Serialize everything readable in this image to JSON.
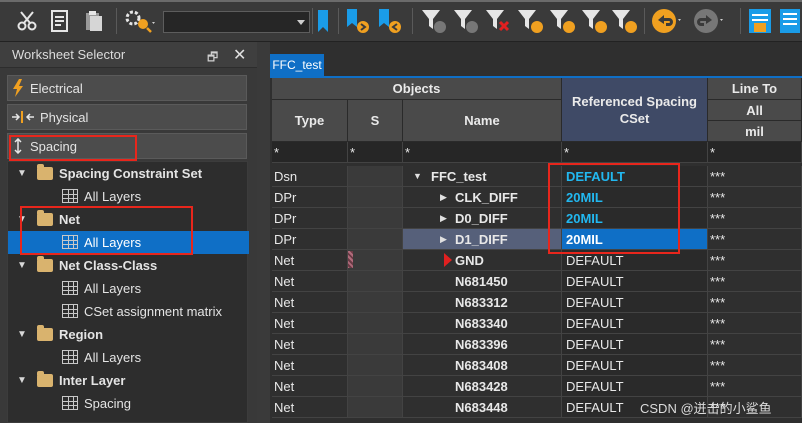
{
  "left_panel": {
    "title": "Worksheet Selector",
    "pin_glyph": "🗗",
    "close_glyph": "✕",
    "categories": [
      {
        "label": "Electrical",
        "icon": "lightning-icon"
      },
      {
        "label": "Physical",
        "icon": "physical-arrows-icon"
      },
      {
        "label": "Spacing",
        "icon": "spacing-icon"
      }
    ],
    "tree": [
      {
        "label": "Spacing Constraint Set",
        "kind": "folder"
      },
      {
        "label": "All Layers",
        "kind": "worksheet"
      },
      {
        "label": "Net",
        "kind": "folder"
      },
      {
        "label": "All Layers",
        "kind": "worksheet",
        "selected": true
      },
      {
        "label": "Net Class-Class",
        "kind": "folder"
      },
      {
        "label": "All Layers",
        "kind": "worksheet"
      },
      {
        "label": "CSet assignment matrix",
        "kind": "worksheet"
      },
      {
        "label": "Region",
        "kind": "folder"
      },
      {
        "label": "All Layers",
        "kind": "worksheet"
      },
      {
        "label": "Inter Layer",
        "kind": "folder"
      },
      {
        "label": "Spacing",
        "kind": "worksheet"
      }
    ]
  },
  "document_tab": "FFC_test",
  "table": {
    "group_objects": "Objects",
    "col_type": "Type",
    "col_s": "S",
    "col_name": "Name",
    "col_ref_line1": "Referenced Spacing",
    "col_ref_line2": "CSet",
    "group_line_to": "Line To",
    "line_to_sub1": "All",
    "line_to_sub2": "mil",
    "filter": "*",
    "rows": [
      {
        "type": "Dsn",
        "name": "FFC_test",
        "ref": "DEFAULT",
        "line": "***"
      },
      {
        "type": "DPr",
        "name": "CLK_DIFF",
        "ref": "20MIL",
        "line": "***"
      },
      {
        "type": "DPr",
        "name": "D0_DIFF",
        "ref": "20MIL",
        "line": "***"
      },
      {
        "type": "DPr",
        "name": "D1_DIFF",
        "ref": "20MIL",
        "line": "***"
      },
      {
        "type": "Net",
        "name": "GND",
        "ref": "DEFAULT",
        "line": "***"
      },
      {
        "type": "Net",
        "name": "N681450",
        "ref": "DEFAULT",
        "line": "***"
      },
      {
        "type": "Net",
        "name": "N683312",
        "ref": "DEFAULT",
        "line": "***"
      },
      {
        "type": "Net",
        "name": "N683340",
        "ref": "DEFAULT",
        "line": "***"
      },
      {
        "type": "Net",
        "name": "N683396",
        "ref": "DEFAULT",
        "line": "***"
      },
      {
        "type": "Net",
        "name": "N683408",
        "ref": "DEFAULT",
        "line": "***"
      },
      {
        "type": "Net",
        "name": "N683428",
        "ref": "DEFAULT",
        "line": "***"
      },
      {
        "type": "Net",
        "name": "N683448",
        "ref": "DEFAULT",
        "line": "***"
      }
    ]
  },
  "watermark": "CSDN @迸击的小鲨鱼",
  "colors": {
    "accent": "#0f6fc6",
    "highlight_box": "#e8261c",
    "cset_cyan": "#22b8f0"
  }
}
